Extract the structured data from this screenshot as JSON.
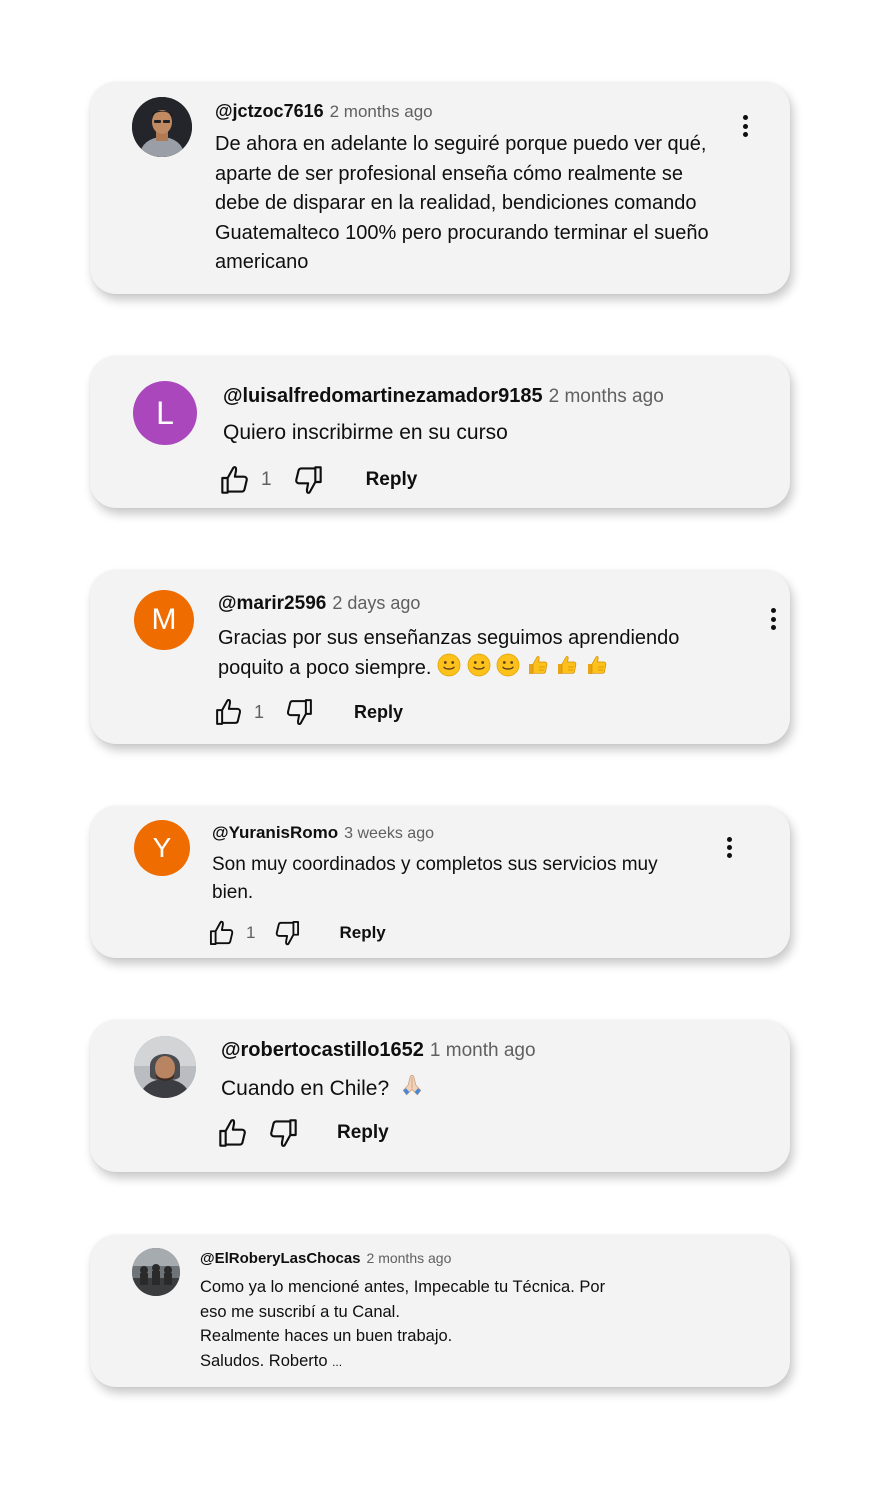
{
  "comments": [
    {
      "handle": "@jctzoc7616",
      "time": "2 months ago",
      "text": "De ahora en adelante lo seguiré porque puedo ver qué, aparte de ser profesional enseña cómo realmente se debe de disparar en la realidad, bendiciones comando Guatemalteco 100% pero procurando terminar el sueño americano"
    },
    {
      "avatar_letter": "L",
      "avatar_color": "#ab47bc",
      "handle": "@luisalfredomartinezamador9185",
      "time": "2 months ago",
      "text": "Quiero inscribirme en su curso",
      "likes": "1",
      "reply_label": "Reply"
    },
    {
      "avatar_letter": "M",
      "avatar_color": "#ef6c00",
      "handle": "@marir2596",
      "time": "2 days ago",
      "text": "Gracias por sus enseñanzas seguimos aprendiendo poquito a poco siempre.",
      "emojis": [
        "slightly-smiling-face",
        "slightly-smiling-face",
        "slightly-smiling-face",
        "thumbs-up",
        "thumbs-up",
        "thumbs-up"
      ],
      "likes": "1",
      "reply_label": "Reply"
    },
    {
      "avatar_letter": "Y",
      "avatar_color": "#ef6c00",
      "handle": "@YuranisRomo",
      "time": "3 weeks ago",
      "text": "Son muy coordinados y completos sus servicios muy bien.",
      "likes": "1",
      "reply_label": "Reply"
    },
    {
      "handle": "@robertocastillo1652",
      "time": "1 month ago",
      "text": "Cuando en Chile?",
      "emoji": "folded-hands",
      "reply_label": "Reply"
    },
    {
      "handle": "@ElRoberyLasChocas",
      "time": "2 months ago",
      "lines": [
        "Como ya lo mencioné antes, Impecable tu Técnica. Por",
        "eso me suscribí a tu Canal.",
        "Realmente haces un buen trabajo.",
        "Saludos. Roberto"
      ],
      "ellipsis": "..."
    }
  ]
}
